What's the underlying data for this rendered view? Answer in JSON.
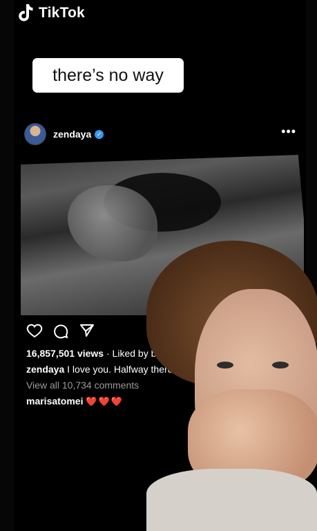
{
  "app": {
    "name": "TikTok"
  },
  "caption": "there’s no way",
  "post": {
    "username": "zendaya",
    "more_label": "•••",
    "views_text": "16,857,501 views",
    "liked_by_text": "· Liked by bow",
    "caption_user": "zendaya",
    "caption_text": "I love you. Halfway there",
    "view_comments": "View all 10,734 comments",
    "comment_user": "marisatomei",
    "comment_text": "❤️❤️❤️"
  },
  "colors": {
    "heart": "#e0262b",
    "verified": "#3897f0"
  },
  "icons": [
    "tiktok-logo",
    "verified-icon",
    "more-icon",
    "heart-icon",
    "comment-icon",
    "share-icon"
  ]
}
